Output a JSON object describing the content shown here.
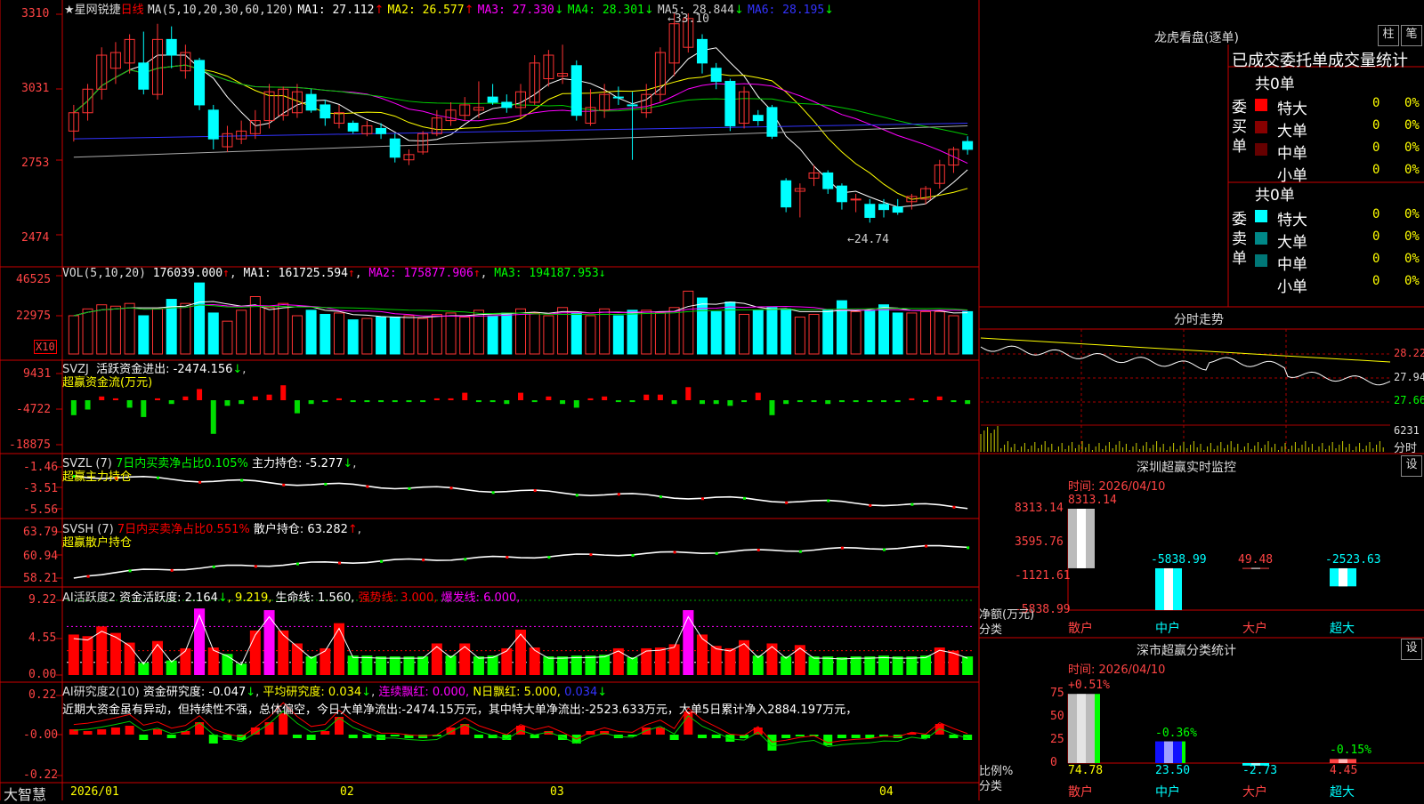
{
  "stock": {
    "star": "★",
    "name": "星网锐捷",
    "period": "日线",
    "ma_label": "MA(5,10,20,30,60,120)",
    "ma1": "MA1: 27.112",
    "ma2": "MA2: 26.577",
    "ma3": "MA3: 27.330",
    "ma4": "MA4: 28.301",
    "ma5": "MA5: 28.844",
    "ma6": "MA6: 28.195",
    "arrow_up": "↑",
    "arrow_down": "↓",
    "high_note": "33.10",
    "low_note": "24.74"
  },
  "price_axis": [
    "3310",
    "3031",
    "2753",
    "2474"
  ],
  "vol": {
    "label": "VOL(5,10,20)",
    "value": "176039.000",
    "ma1": "MA1: 161725.594",
    "ma2": "MA2: 175877.906",
    "ma3": "MA3: 194187.953",
    "axis": [
      "46525",
      "22975"
    ],
    "unit": "X10"
  },
  "svzj": {
    "label": "SVZJ",
    "title": "活跃资金进出: -2474.156",
    "sub": "超赢资金流(万元)",
    "axis": [
      "9431",
      "-4722",
      "-18875"
    ]
  },
  "svzl": {
    "label": "SVZL (7)",
    "title": "7日内买卖净占比0.105%",
    "hold": "主力持仓: -5.277",
    "sub": "超赢主力持仓",
    "axis": [
      "-1.46",
      "-3.51",
      "-5.56"
    ]
  },
  "svsh": {
    "label": "SVSH (7)",
    "title": "7日内买卖净占比0.551%",
    "hold": "散户持仓: 63.282",
    "sub": "超赢散户持仓",
    "axis": [
      "63.79",
      "60.94",
      "58.21"
    ]
  },
  "ai1": {
    "label": "AI活跃度2",
    "a": "资金活跃度: 2.164",
    "b": ", 9.219,",
    "c": "生命线: 1.560,",
    "d": "强势线: 3.000,",
    "e": "爆发线: 6.000,",
    "axis": [
      "9.22",
      "4.55",
      "0.00"
    ]
  },
  "ai2": {
    "label": "AI研究度2(10)",
    "a": "资金研究度: -0.047",
    "b": "平均研究度: 0.034",
    "c": "连续飘红: 0.000,",
    "d": "N日飘红: 5.000,",
    "e": "0.034",
    "comment": "近期大资金虽有异动，但持续性不强，总体偏空，今日大单净流出:-2474.15万元，其中特大单净流出:-2523.633万元，大单5日累计净入2884.197万元，",
    "axis": [
      "0.22",
      "-0.00",
      "-0.22"
    ]
  },
  "xaxis": {
    "brand": "大智慧",
    "labels": [
      "2026/01",
      "02",
      "03",
      "04"
    ]
  },
  "right": {
    "longhu_title": "龙虎看盘(逐单)",
    "btn_zhu": "柱",
    "btn_bi": "笔",
    "stat_title": "已成交委托单成交量统计",
    "buy_label": "委买单",
    "sell_label": "委卖单",
    "buy_total": "共0单",
    "sell_total": "共0单",
    "rows": [
      {
        "name": "特大",
        "v": "0",
        "p": "0%"
      },
      {
        "name": "大单",
        "v": "0",
        "p": "0%"
      },
      {
        "name": "中单",
        "v": "0",
        "p": "0%"
      },
      {
        "name": "小单",
        "v": "0",
        "p": "0%"
      }
    ],
    "fenshi_title": "分时走势",
    "fenshi_axis": [
      "28.22",
      "27.94",
      "27.66"
    ],
    "fenshi_vol": "6231",
    "fenshi_unit": "分时",
    "mon_title": "深圳超赢实时监控",
    "btn_set": "设",
    "mon_time": "时间: 2026/04/10",
    "mon_axis": [
      "8313.14",
      "3595.76",
      "-1121.61",
      "-5838.99"
    ],
    "mon_bars": [
      {
        "label": "散户",
        "value": "8313.14"
      },
      {
        "label": "中户",
        "value": "-5838.99"
      },
      {
        "label": "大户",
        "value": "49.48"
      },
      {
        "label": "超大",
        "value": "-2523.63"
      }
    ],
    "mon_ylabel": "净额(万元)",
    "mon_xlabel": "分类",
    "cls_title": "深市超赢分类统计",
    "cls_time": "时间: 2026/04/10",
    "cls_axis": [
      "75",
      "50",
      "25",
      "0"
    ],
    "cls_bars": [
      {
        "label": "散户",
        "value": "74.78",
        "chg": "+0.51%"
      },
      {
        "label": "中户",
        "value": "23.50",
        "chg": "-0.36%"
      },
      {
        "label": "大户",
        "value": "-2.73",
        "chg": ""
      },
      {
        "label": "超大",
        "value": "4.45",
        "chg": "-0.15%"
      }
    ],
    "cls_ylabel": "比例%",
    "cls_xlabel": "分类"
  },
  "chart_data": {
    "type": "candlestick",
    "title": "星网锐捷 日线",
    "ylim": [
      24.5,
      33.2
    ],
    "candles": [
      [
        28.6,
        29.3,
        28.2,
        29.6,
        "u"
      ],
      [
        29.3,
        30.2,
        29.0,
        30.4,
        "u"
      ],
      [
        30.2,
        31.5,
        29.8,
        31.8,
        "u"
      ],
      [
        31.0,
        31.6,
        30.4,
        32.0,
        "u"
      ],
      [
        31.2,
        32.1,
        30.8,
        32.3,
        "u"
      ],
      [
        31.2,
        30.2,
        30.0,
        32.4,
        "d"
      ],
      [
        30.0,
        32.1,
        29.8,
        32.7,
        "u"
      ],
      [
        32.1,
        31.5,
        31.0,
        32.6,
        "d"
      ],
      [
        30.9,
        31.6,
        30.6,
        31.9,
        "u"
      ],
      [
        31.3,
        29.6,
        29.4,
        31.4,
        "d"
      ],
      [
        29.4,
        28.3,
        27.9,
        29.6,
        "d"
      ],
      [
        28.0,
        28.5,
        27.8,
        28.8,
        "u"
      ],
      [
        28.3,
        28.6,
        28.1,
        29.0,
        "u"
      ],
      [
        28.5,
        29.0,
        28.3,
        29.4,
        "u"
      ],
      [
        29.0,
        30.1,
        28.7,
        30.4,
        "u"
      ],
      [
        29.2,
        30.2,
        29.0,
        30.3,
        "u"
      ],
      [
        29.3,
        30.1,
        29.1,
        30.4,
        "u"
      ],
      [
        30.0,
        29.4,
        29.3,
        30.2,
        "d"
      ],
      [
        29.6,
        29.1,
        28.8,
        29.8,
        "d"
      ],
      [
        28.9,
        29.3,
        28.7,
        29.6,
        "u"
      ],
      [
        28.9,
        28.6,
        28.5,
        29.0,
        "d"
      ],
      [
        28.5,
        28.8,
        28.4,
        29.0,
        "u"
      ],
      [
        28.7,
        28.5,
        28.3,
        28.9,
        "d"
      ],
      [
        28.3,
        27.6,
        27.4,
        28.5,
        "d"
      ],
      [
        27.5,
        27.7,
        27.3,
        27.9,
        "u"
      ],
      [
        27.8,
        28.5,
        27.7,
        28.6,
        "u"
      ],
      [
        28.5,
        29.1,
        28.4,
        29.4,
        "u"
      ],
      [
        29.0,
        29.4,
        28.8,
        29.7,
        "u"
      ],
      [
        29.2,
        29.6,
        29.0,
        29.9,
        "u"
      ],
      [
        29.4,
        29.5,
        29.1,
        30.5,
        "u"
      ],
      [
        29.9,
        29.7,
        29.6,
        30.4,
        "d"
      ],
      [
        29.7,
        29.5,
        29.3,
        30.0,
        "d"
      ],
      [
        29.5,
        30.1,
        29.1,
        30.4,
        "u"
      ],
      [
        29.7,
        31.2,
        29.6,
        31.5,
        "u"
      ],
      [
        30.6,
        31.5,
        30.3,
        31.7,
        "u"
      ],
      [
        30.8,
        30.7,
        30.4,
        31.9,
        "u"
      ],
      [
        31.1,
        29.2,
        29.0,
        31.3,
        "d"
      ],
      [
        28.9,
        29.5,
        28.8,
        30.2,
        "u"
      ],
      [
        29.4,
        30.0,
        29.1,
        30.4,
        "u"
      ],
      [
        29.9,
        29.9,
        29.6,
        30.3,
        "d"
      ],
      [
        29.6,
        29.6,
        27.5,
        30.1,
        "d"
      ],
      [
        29.3,
        30.0,
        29.1,
        30.4,
        "u"
      ],
      [
        30.0,
        31.6,
        29.7,
        31.8,
        "u"
      ],
      [
        31.2,
        32.7,
        30.7,
        33.1,
        "u"
      ],
      [
        31.8,
        32.9,
        31.6,
        33.1,
        "u"
      ],
      [
        32.1,
        31.2,
        30.8,
        32.3,
        "d"
      ],
      [
        31.0,
        30.5,
        30.2,
        31.2,
        "d"
      ],
      [
        30.5,
        28.8,
        28.6,
        30.6,
        "d"
      ],
      [
        28.9,
        30.1,
        28.7,
        30.3,
        "u"
      ],
      [
        29.2,
        29.0,
        28.8,
        29.4,
        "d"
      ],
      [
        29.5,
        28.4,
        28.3,
        29.6,
        "d"
      ],
      [
        26.7,
        25.7,
        25.5,
        26.8,
        "d"
      ],
      [
        26.3,
        26.4,
        25.3,
        26.6,
        "u"
      ],
      [
        27.0,
        26.8,
        26.5,
        27.3,
        "u"
      ],
      [
        27.0,
        26.4,
        26.2,
        27.1,
        "d"
      ],
      [
        26.5,
        25.9,
        25.6,
        26.6,
        "d"
      ],
      [
        26.0,
        26.0,
        25.5,
        26.2,
        "u"
      ],
      [
        25.8,
        25.3,
        25.1,
        26.0,
        "d"
      ],
      [
        25.6,
        25.8,
        25.3,
        26.0,
        "d"
      ],
      [
        25.7,
        25.5,
        25.4,
        26.0,
        "d"
      ],
      [
        25.9,
        26.1,
        25.6,
        26.2,
        "u"
      ],
      [
        26.0,
        26.4,
        25.8,
        26.5,
        "u"
      ],
      [
        26.6,
        27.3,
        26.4,
        27.5,
        "u"
      ],
      [
        27.3,
        27.9,
        27.0,
        28.0,
        "u"
      ],
      [
        28.2,
        27.9,
        27.7,
        28.4,
        "d"
      ]
    ],
    "volume": [
      140,
      165,
      180,
      175,
      185,
      140,
      165,
      200,
      185,
      260,
      150,
      120,
      160,
      210,
      170,
      185,
      140,
      160,
      145,
      150,
      125,
      130,
      135,
      135,
      140,
      130,
      145,
      150,
      135,
      160,
      140,
      150,
      165,
      150,
      140,
      170,
      150,
      140,
      165,
      140,
      160,
      160,
      150,
      170,
      230,
      205,
      155,
      190,
      145,
      160,
      170,
      165,
      135,
      145,
      160,
      195,
      155,
      160,
      180,
      150,
      150,
      155,
      155,
      140,
      155
    ],
    "fund_flow": [
      -40,
      -25,
      10,
      5,
      -20,
      -45,
      5,
      -10,
      10,
      30,
      -90,
      -15,
      -10,
      10,
      15,
      40,
      -35,
      -10,
      -5,
      5,
      -5,
      -5,
      -5,
      -5,
      -5,
      -5,
      5,
      5,
      20,
      -5,
      -5,
      -10,
      20,
      -5,
      10,
      -10,
      -20,
      5,
      10,
      -5,
      -5,
      15,
      15,
      -10,
      35,
      -10,
      -10,
      -15,
      -5,
      20,
      -40,
      -10,
      -5,
      -5,
      -10,
      -5,
      -5,
      -5,
      -5,
      -5,
      5,
      -5,
      10,
      -5,
      -10
    ],
    "ai_active": [
      5,
      4.8,
      6,
      5.2,
      4,
      1.5,
      4.2,
      1.8,
      3.3,
      8.2,
      3.4,
      2.6,
      1.4,
      5.5,
      8,
      5.5,
      3.9,
      2.3,
      3.3,
      6.4,
      2.4,
      2.4,
      2.3,
      2.3,
      2.3,
      2.3,
      3.9,
      2.4,
      3.9,
      2.3,
      2.4,
      3.3,
      5.6,
      3.4,
      2.3,
      2.3,
      2.4,
      2.4,
      2.5,
      3.3,
      2.2,
      3.3,
      3.4,
      3.8,
      8,
      5,
      3.6,
      3.3,
      4.3,
      2.4,
      3.9,
      2.3,
      3.7,
      2.3,
      2.3,
      2.2,
      2.3,
      2.3,
      2.4,
      2.3,
      2.3,
      2.4,
      3.4,
      3.0,
      2.3
    ],
    "ai_research": [
      0.03,
      0.02,
      0.03,
      0.04,
      0.05,
      -0.03,
      0.03,
      -0.02,
      0.02,
      0.07,
      -0.05,
      -0.03,
      -0.03,
      0.04,
      0.07,
      0.12,
      -0.02,
      -0.03,
      0.02,
      0.1,
      -0.02,
      -0.02,
      -0.03,
      -0.01,
      -0.02,
      -0.02,
      -0.01,
      0.04,
      0.06,
      -0.02,
      -0.02,
      -0.03,
      0.05,
      -0.02,
      0.02,
      -0.03,
      -0.05,
      0.02,
      0.02,
      -0.02,
      -0.01,
      0.04,
      0.04,
      -0.03,
      0.13,
      -0.02,
      -0.02,
      -0.04,
      -0.02,
      0.04,
      -0.09,
      -0.02,
      -0.01,
      -0.01,
      -0.06,
      -0.02,
      -0.02,
      -0.02,
      -0.01,
      -0.02,
      0.01,
      -0.02,
      0.06,
      -0.02,
      -0.03
    ]
  }
}
